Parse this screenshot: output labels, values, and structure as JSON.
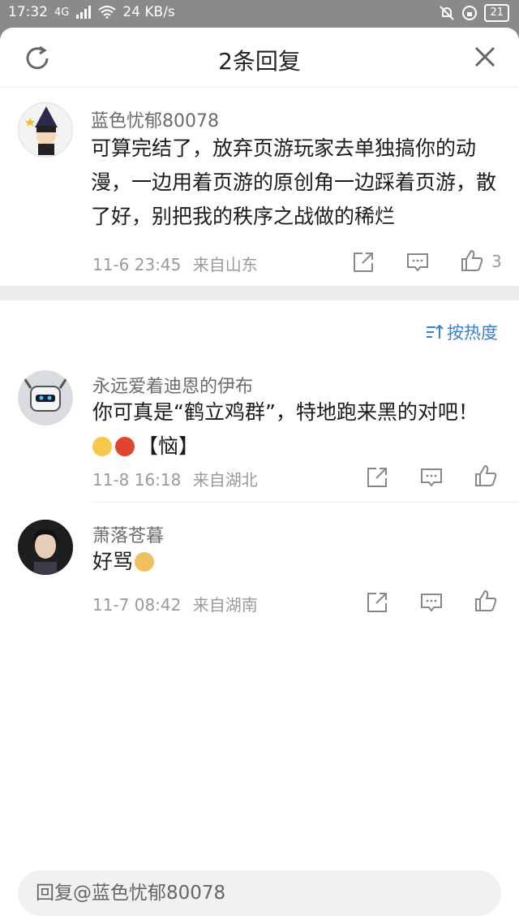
{
  "status_bar": {
    "time": "17:32",
    "signal": "4G",
    "speed": "24 KB/s",
    "battery": "21"
  },
  "header": {
    "title": "2条回复"
  },
  "main_comment": {
    "username": "蓝色忧郁80078",
    "text": "可算完结了，放弃页游玩家去单独搞你的动漫，一边用着页游的原创角一边踩着页游，散了好，别把我的秩序之战做的稀烂",
    "time": "11-6 23:45",
    "location": "来自山东",
    "likes": "3"
  },
  "sort": {
    "label": "按热度"
  },
  "replies": [
    {
      "username": "永远爱着迪恩的伊布",
      "text": "你可真是“鹤立鸡群”，特地跑来黑的对吧！",
      "text2": "【恼】",
      "time": "11-8 16:18",
      "location": "来自湖北"
    },
    {
      "username": "萧落苍暮",
      "text": "好骂",
      "time": "11-7 08:42",
      "location": "来自湖南"
    }
  ],
  "reply_input": {
    "placeholder": "回复@蓝色忧郁80078"
  }
}
